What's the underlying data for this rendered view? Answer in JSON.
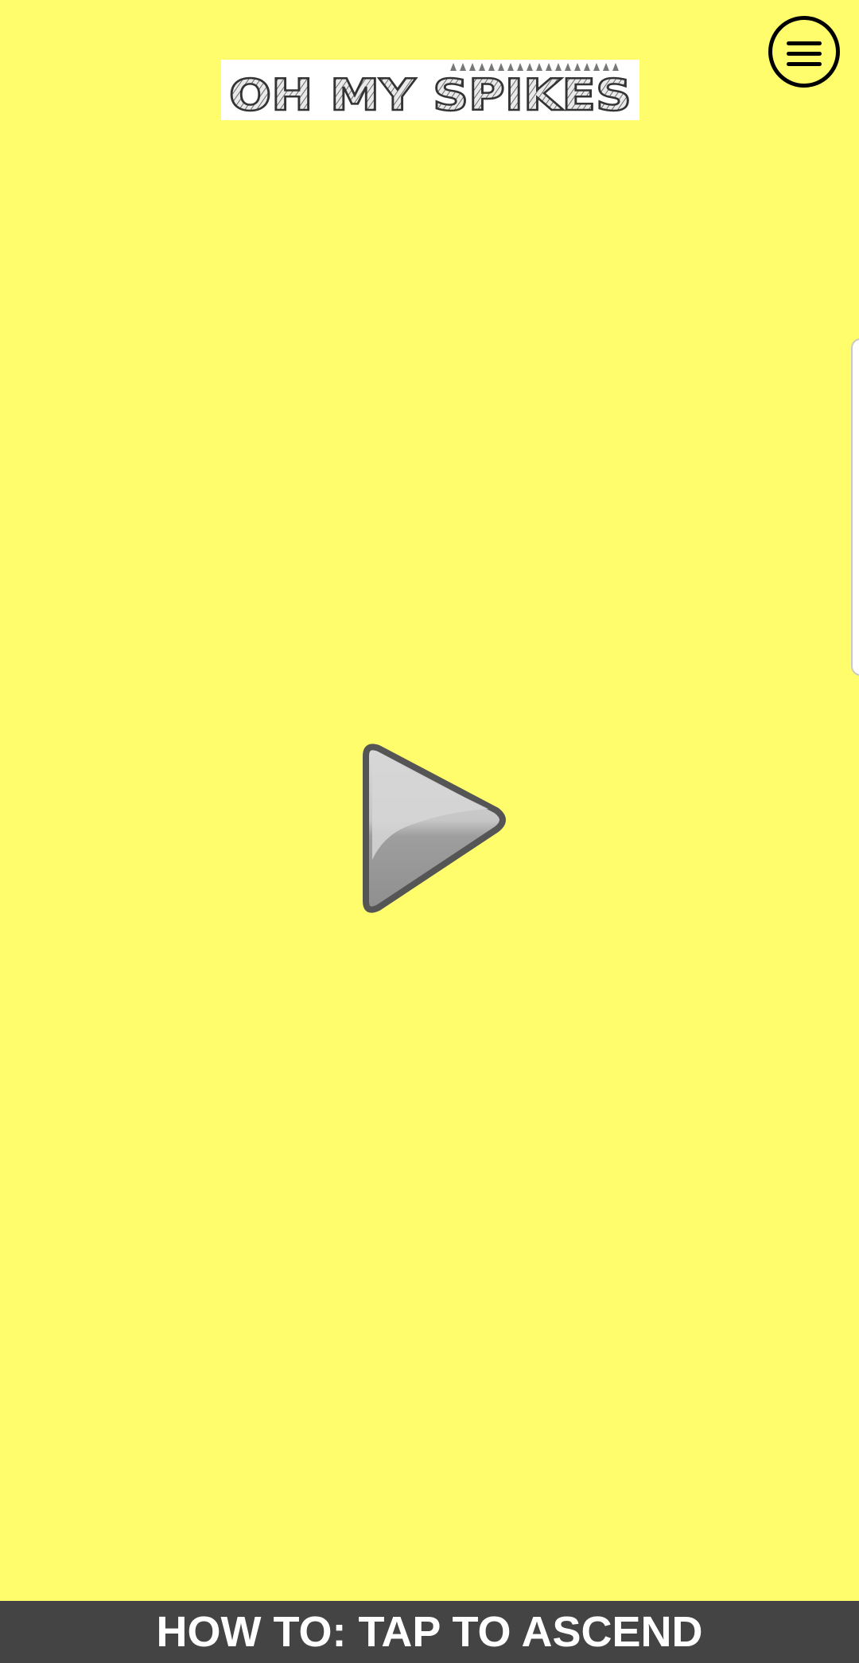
{
  "game": {
    "title": "OH MY SPIKES",
    "instruction": "HOW TO: TAP TO ASCEND"
  },
  "icons": {
    "menu": "hamburger-menu-icon",
    "play": "play-icon"
  },
  "colors": {
    "background": "#fffd6b",
    "bottom_bar": "#444444",
    "instruction_text": "#ffffff",
    "play_fill": "#b5b5b5",
    "play_outline": "#555555"
  }
}
